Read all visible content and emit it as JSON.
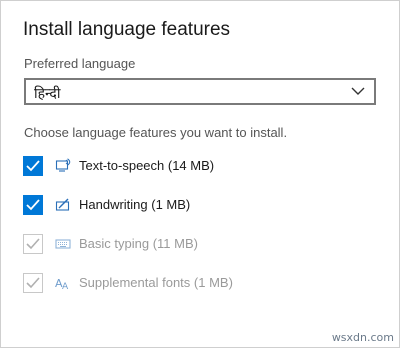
{
  "dialog": {
    "title": "Install language features",
    "preferred_label": "Preferred language",
    "selected_language": "हिन्दी",
    "choose_label": "Choose language features you want to install.",
    "options": [
      {
        "label": "Text-to-speech (14 MB)",
        "checked": true,
        "enabled": true,
        "icon": "speech-icon"
      },
      {
        "label": "Handwriting (1 MB)",
        "checked": true,
        "enabled": true,
        "icon": "handwriting-icon"
      },
      {
        "label": "Basic typing (11 MB)",
        "checked": true,
        "enabled": false,
        "icon": "keyboard-icon"
      },
      {
        "label": "Supplemental fonts (1 MB)",
        "checked": true,
        "enabled": false,
        "icon": "fonts-icon"
      }
    ]
  },
  "watermark": "wsxdn.com",
  "colors": {
    "accent": "#0078d7",
    "disabled_check": "#b0b0b0",
    "disabled_text": "#9a9a9a"
  }
}
